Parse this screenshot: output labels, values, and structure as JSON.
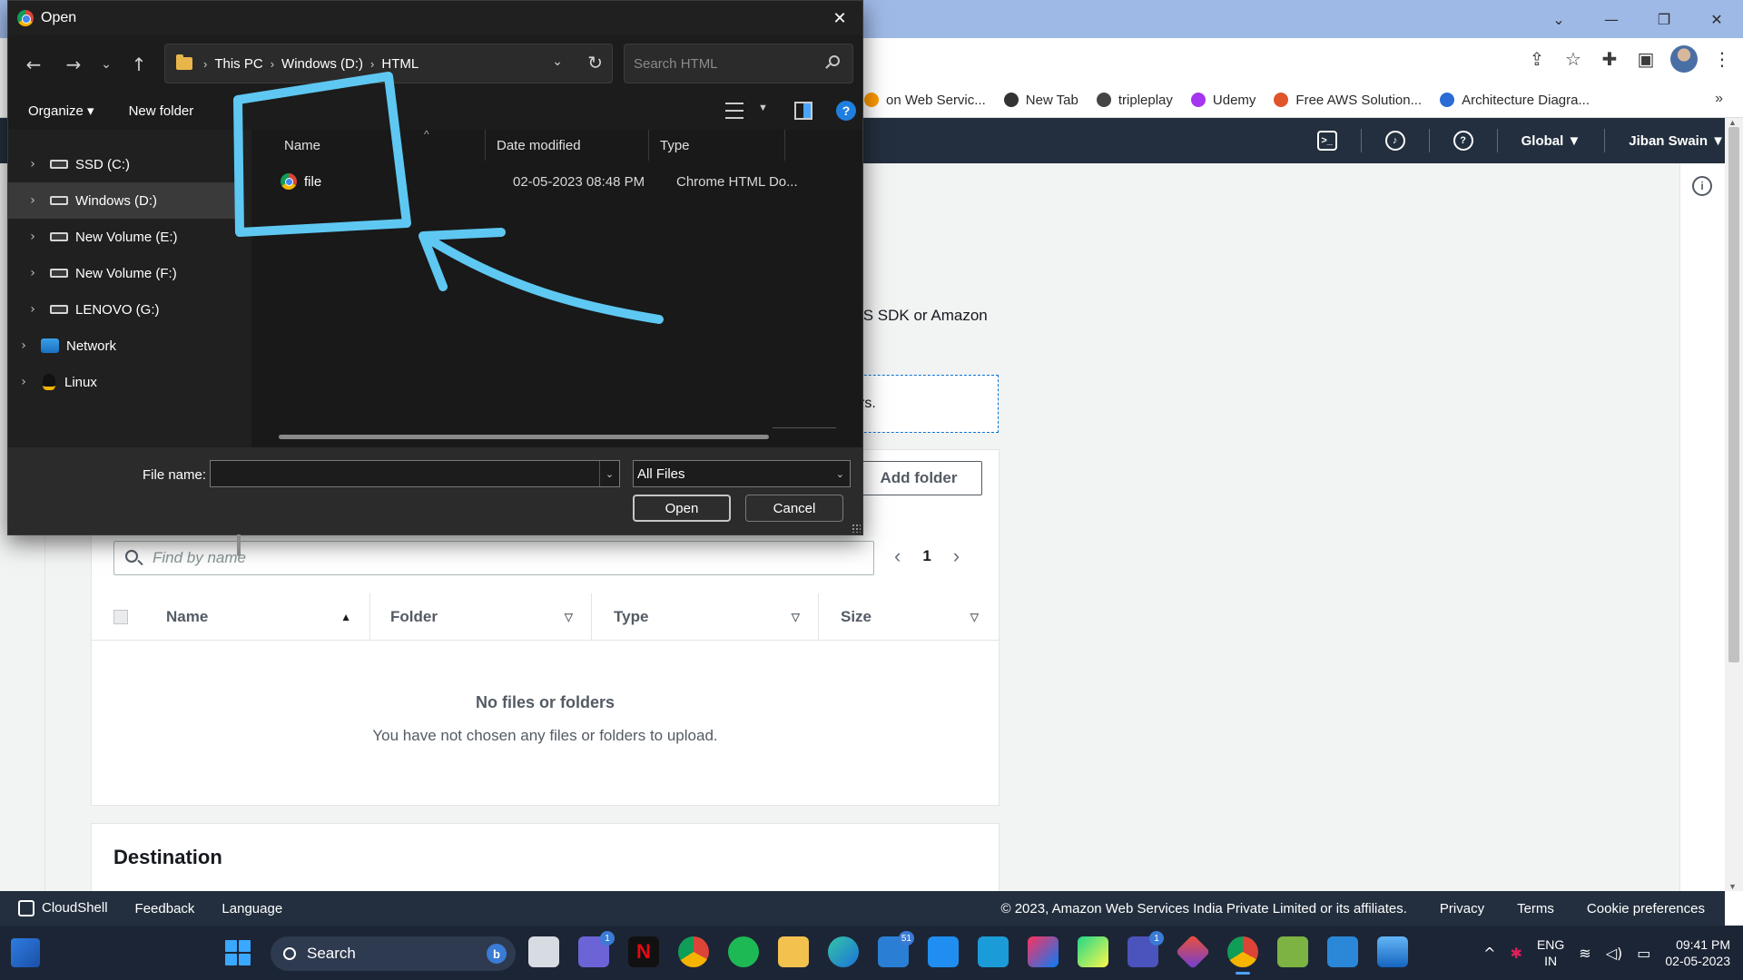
{
  "browser": {
    "bookmarks": [
      {
        "label": "on Web Servic...",
        "icon": "aws-icon",
        "color": "#ff9900"
      },
      {
        "label": "New Tab",
        "icon": "globe-icon",
        "color": "#333333"
      },
      {
        "label": "tripleplay",
        "icon": "hashnode-icon",
        "color": "#444444"
      },
      {
        "label": "Udemy",
        "icon": "udemy-icon",
        "color": "#a435f0"
      },
      {
        "label": "Free AWS Solution...",
        "icon": "aws-solution-icon",
        "color": "#e0542b"
      },
      {
        "label": "Architecture Diagra...",
        "icon": "diagram-icon",
        "color": "#2a6bd6"
      }
    ],
    "bookmarks_more": "»"
  },
  "aws": {
    "nav": {
      "region": "Global ▼",
      "user": "Jiban Swain ▼"
    },
    "fragment_text": "/S SDK or Amazon",
    "drop_zone_text": "rs.",
    "add_folder": "Add folder",
    "find_placeholder": "Find by name",
    "page_number": "1",
    "table_headers": {
      "name": "Name",
      "folder": "Folder",
      "type": "Type",
      "size": "Size"
    },
    "empty_title": "No files or folders",
    "empty_subtitle": "You have not chosen any files or folders to upload.",
    "destination": "Destination",
    "footer": {
      "cloudshell": "CloudShell",
      "feedback": "Feedback",
      "language": "Language",
      "copyright": "© 2023, Amazon Web Services India Private Limited or its affiliates.",
      "privacy": "Privacy",
      "terms": "Terms",
      "cookies": "Cookie preferences"
    }
  },
  "dialog": {
    "title": "Open",
    "breadcrumb": [
      "This PC",
      "Windows (D:)",
      "HTML"
    ],
    "search_placeholder": "Search HTML",
    "organize": "Organize ▾",
    "new_folder": "New folder",
    "nav_items": [
      {
        "label": "SSD (C:)",
        "type": "drive"
      },
      {
        "label": "Windows (D:)",
        "type": "drive",
        "selected": true
      },
      {
        "label": "New Volume (E:)",
        "type": "drive"
      },
      {
        "label": "New Volume (F:)",
        "type": "drive"
      },
      {
        "label": "LENOVO (G:)",
        "type": "drive"
      },
      {
        "label": "Network",
        "type": "network"
      },
      {
        "label": "Linux",
        "type": "linux"
      }
    ],
    "columns": {
      "name": "Name",
      "date": "Date modified",
      "type": "Type"
    },
    "files": [
      {
        "name": "file",
        "date": "02-05-2023 08:48 PM",
        "type": "Chrome HTML Do..."
      }
    ],
    "file_name_label": "File name:",
    "file_name_value": "",
    "filter": "All Files",
    "open": "Open",
    "cancel": "Cancel"
  },
  "taskbar": {
    "search": "Search",
    "badges": {
      "teams_chat": "1",
      "mail": "51",
      "teams": "1"
    },
    "lang_top": "ENG",
    "lang_bottom": "IN",
    "time": "09:41 PM",
    "date": "02-05-2023"
  },
  "colors": {
    "aws_nav": "#232f3e",
    "annotation": "#5ec8f2",
    "dialog_bg": "#202020",
    "taskbar": "#1c2536"
  }
}
